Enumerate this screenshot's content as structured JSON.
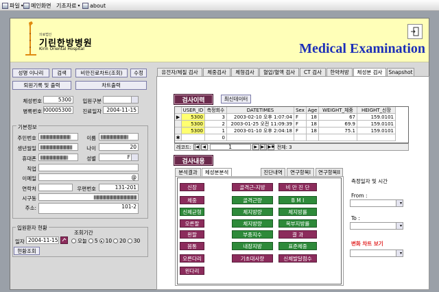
{
  "menubar": {
    "items": [
      {
        "label": "파일",
        "has_dropdown": true,
        "icon": "doc-icon"
      },
      {
        "label": "메인화면",
        "has_dropdown": false,
        "icon": "window-icon"
      },
      {
        "label": "기초자료",
        "has_dropdown": true,
        "icon": ""
      },
      {
        "label": "about",
        "has_dropdown": false,
        "icon": "info-icon"
      }
    ]
  },
  "header": {
    "logo_small": "의료법인",
    "logo_main": "기린한방병원",
    "logo_en": "Kirin Oriental Hospital",
    "title": "Medical Examination",
    "title_color": "#1c2fb8",
    "bg_color": "#ffffb8"
  },
  "left_buttons": {
    "row1": [
      "성명 이나리",
      "검색",
      "비만진료차트(조회)",
      "수정"
    ],
    "row2": [
      "퇴원기록 및 출력",
      "차트출력"
    ]
  },
  "patient": {
    "chart_no_label": "체성번호",
    "chart_no": "5300",
    "admit_type_label": "입원구분",
    "admit_type": "",
    "disease_no_label": "병록번호",
    "disease_no": "000005300",
    "visit_date_label": "진료일자",
    "visit_date": "2004-11-15"
  },
  "basic_info": {
    "title": "기본정보",
    "rrn_label": "주민번호",
    "name_label": "이름",
    "birth_label": "생년월일",
    "age_label": "나이",
    "age": "20",
    "phone_label": "휴대폰",
    "gender_label": "성별",
    "gender": "F",
    "job_label": "직업",
    "email_label": "이메일",
    "email_suffix": "@",
    "contact_label": "연락처",
    "zip_label": "우편번호",
    "zip": "131-201",
    "city_label": "시구동",
    "address_label": "주소:",
    "address": "101-2"
  },
  "inpatient": {
    "title": "입원환자 현황",
    "period_label": "조회기간",
    "date_label": "일자",
    "date": "2004-11-15",
    "options": [
      "오늘",
      "5",
      "10",
      "20",
      "30"
    ],
    "selected": 2,
    "view_button": "현황조회"
  },
  "tabs": [
    "유전자/체질 검사",
    "체중검사",
    "체형검사",
    "혈압/혈액 검사",
    "CT 검사",
    "한약처방",
    "체성분 검사",
    "Snapshot"
  ],
  "active_tab": 6,
  "history": {
    "title": "검사이력",
    "latest_button": "최신데이터",
    "columns": [
      "USER_ID",
      "측정회수",
      "DATETIMES",
      "Sex",
      "Age",
      "WEIGHT_체중",
      "HEIGHT_신장"
    ],
    "rows": [
      [
        "5300",
        "3",
        "2003-02-10 오후 1:07:04",
        "F",
        "18",
        "67",
        "159.0101"
      ],
      [
        "5300",
        "2",
        "2003-01-25 오전 11:09:39",
        "F",
        "18",
        "69.9",
        "159.0101"
      ],
      [
        "5300",
        "1",
        "2003-01-10 오후 2:04:18",
        "F",
        "18",
        "75.1",
        "159.0101"
      ],
      [
        "",
        "0",
        "",
        "",
        "",
        "",
        ""
      ]
    ],
    "nav_label": "레코드:",
    "current_record": "1",
    "total_label": "전체: 3"
  },
  "content": {
    "title": "검사내용",
    "tabs": [
      "분석결과",
      "체성분분석",
      "진단내역",
      "연구항목I",
      "연구항목II"
    ],
    "active_tab": 1,
    "red_buttons": [
      {
        "label": "신장",
        "col": 0,
        "row": 0
      },
      {
        "label": "골격근-지방",
        "col": 1,
        "row": 0
      },
      {
        "label": "비 만 진 단",
        "col": 2,
        "row": 0
      },
      {
        "label": "체중",
        "col": 0,
        "row": 1
      },
      {
        "label": "오른팔",
        "col": 0,
        "row": 3
      },
      {
        "label": "왼팔",
        "col": 0,
        "row": 4
      },
      {
        "label": "몸통",
        "col": 0,
        "row": 5
      },
      {
        "label": "오른다리",
        "col": 0,
        "row": 6
      },
      {
        "label": "왼다리",
        "col": 0,
        "row": 7
      },
      {
        "label": "기초대사량",
        "col": 1,
        "row": 6
      },
      {
        "label": "결 과",
        "col": 2,
        "row": 4
      },
      {
        "label": "신체발달점수",
        "col": 2,
        "row": 6
      }
    ],
    "green_buttons": [
      {
        "label": "신체균형",
        "col": 0,
        "row": 2
      },
      {
        "label": "골격근량",
        "col": 1,
        "row": 1
      },
      {
        "label": "체지방량",
        "col": 1,
        "row": 2
      },
      {
        "label": "체지방량",
        "col": 1,
        "row": 3
      },
      {
        "label": "부종지수",
        "col": 1,
        "row": 4
      },
      {
        "label": "내장지방",
        "col": 1,
        "row": 5
      },
      {
        "label": "B M I",
        "col": 2,
        "row": 1
      },
      {
        "label": "체지방률",
        "col": 2,
        "row": 2
      },
      {
        "label": "복부지방률",
        "col": 2,
        "row": 3
      },
      {
        "label": "표준체중",
        "col": 2,
        "row": 5
      }
    ],
    "red_color": "#8c2c5c",
    "green_color": "#2e8a3a"
  },
  "side_panel": {
    "title": "측정일자 및 시간",
    "from_label": "From :",
    "to_label": "To :",
    "chart_label": "변화 차트 보기",
    "chart_label_color": "#e02020"
  }
}
